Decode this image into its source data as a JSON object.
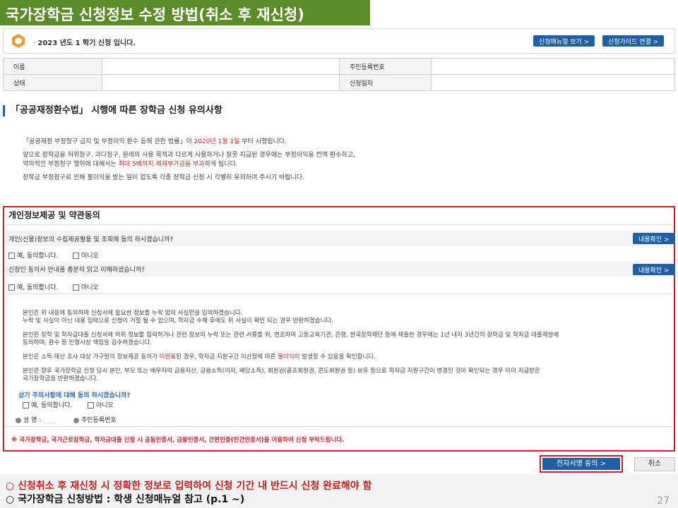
{
  "slide": {
    "title": "국가장학금 신청정보 수정 방법(취소 후 재신청)",
    "page_number": "27"
  },
  "header": {
    "notice_prefix": "·",
    "notice": "2023 년도 1 학기 신청 입니다.",
    "manual_button": "신청매뉴얼 보기  >",
    "guide_button": "신청가이드 연결  >"
  },
  "info_table": {
    "name_label": "이름",
    "name_value": "",
    "rrn_label": "주민등록번호",
    "rrn_value": "",
    "status_label": "상태",
    "status_value": "",
    "date_label": "신청일자",
    "date_value": ""
  },
  "notice_section": {
    "title": "「공공재정환수법」 시행에 따른 장학금 신청 유의사항",
    "line1_a": "「공공재정 부정청구 금지 및 부정이익 환수 등에 관한 법률」이 ",
    "line1_red": "2020년 1월 1일",
    "line1_b": " 부터 시행됩니다.",
    "line2": "앞으로 장학금을 허위청구, 과다청구, 원래의 사용 목적과 다르게 사용하거나 잘못 지급된 경우에는 부정이익을 전액 환수하고,",
    "line3_a": "악의적인 부정청구 행위에 대해서는 ",
    "line3_red": "최대 5배까지 제재부가금을 부과",
    "line3_b": "하게 됩니다.",
    "line4": "장학금 부정청구로 인해 불이익을 받는 일이 없도록 각종 장학금 신청 시 각별히 유의하여 주시기 바랍니다."
  },
  "consent": {
    "title": "개인정보제공 및 약관동의",
    "q1": "개인(신용)정보의 수집제공활용 및 조회에 동의 하시겠습니까?",
    "q2": "신청인 동의서 안내를 충분히 읽고 이해하셨습니까?",
    "view_button": "내용확인  >",
    "agree": "예, 동의합니다.",
    "disagree": "아니오",
    "p1a": "본인은 위 내용에 동의하며 신청서에 필요한 정보를 누락 없이 사실만을 입력하겠습니다.",
    "p1b": "누락 및 사실이 아닌 내용 입력으로 신청이 거절 될 수 있으며, 학자금 수혜 후에도 위 사실이 확인 되는 경우 반환하겠습니다.",
    "p2a": "본인은 장학 및 학자금대출 신청서에 허위 정보를 입력하거나 관련 정보의 누락 또는 관련 서류를 위, 변조하여 고등교육기관, 은행, 한국장학재단 등에 제출한 경우에는 1년 내지 3년간의 장학금 및 학자금 대출제한에",
    "p2b": "동의하며, 환수 등 민형사상 책임을 감수하겠습니다.",
    "p3_a": "본인은 소득·재산 조사 대상 가구원의 정보제공 동의가 ",
    "p3_red1": "미완료",
    "p3_b": "된 경우, 학자금 지원구간 미산정에 따른 ",
    "p3_red2": "불이익",
    "p3_c": "이 발생할 수 있음을 확인합니다.",
    "p4a": "본인은 향후 국가장학금 신청 당시 본인, 부모 또는 배우자의 금융자산, 금융소득(이자, 배당소득), 회원권(골프회원권, 콘도회원권 등) 보유 등으로 학자금 지원구간이 변경된 것이 확인되는 경우 이미 지급받은",
    "p4b": "국가장학금을 반환하겠습니다.",
    "final_q": "상기 주의사항에 대해 동의 하시겠습니까?",
    "name_label": "성 명 :",
    "rrn_label": "주민등록번호",
    "warning": "※ 국가장학금, 국가근로장학금, 학자금대출 신청 시 공동인증서, 금융인증서, 간편인증(민간인증서)을 이용하여 신청 부탁드립니다."
  },
  "actions": {
    "sign_button": "전자서명 동의  >",
    "cancel_button": "취소"
  },
  "footer": {
    "bullet1": "○ 신청취소 후 재신청 시 정확한 정보로 입력하여 신청 기간 내 반드시 신청 완료해야 함",
    "bullet2": "○ 국가장학금 신청방법 : 학생 신청매뉴얼 참고 (p.1 ~)"
  },
  "colors": {
    "title_bg": "#5b8c2a",
    "accent_blue": "#1f5fa8",
    "highlight_red": "#d01f2a"
  },
  "icons": {
    "logo": "hexagon-logo-icon"
  }
}
